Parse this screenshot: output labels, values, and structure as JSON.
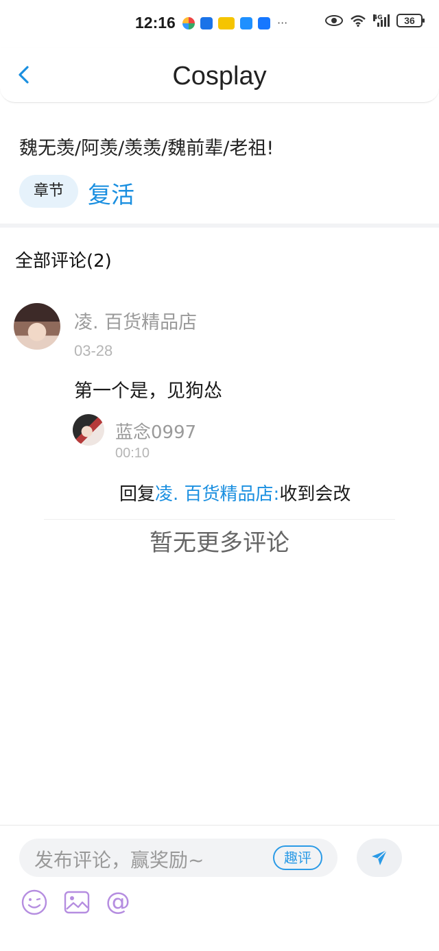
{
  "status_bar": {
    "time": "12:16",
    "dots": "···",
    "network": "4G",
    "battery": "36"
  },
  "header": {
    "back_icon": "chevron-left-icon",
    "title": "Cosplay"
  },
  "post": {
    "text": "魏无羡/阿羡/羡羡/魏前辈/老祖!",
    "chapter_tag": "章节",
    "chapter_name": "复活"
  },
  "comments": {
    "title": "全部评论(2)",
    "items": [
      {
        "user": "凌. 百货精品店",
        "date": "03-28",
        "text": "第一个是，见狗怂",
        "reply": {
          "user": "蓝念0997",
          "time": "00:10",
          "prefix": "回复",
          "mention": "凌. 百货精品店:",
          "text": "收到会改"
        }
      }
    ],
    "no_more": "暂无更多评论"
  },
  "bottom_bar": {
    "placeholder": "发布评论，赢奖励~",
    "badge": "趣评",
    "tools": [
      "emoji-icon",
      "image-icon",
      "at-icon"
    ],
    "at_symbol": "@"
  },
  "colors": {
    "accent": "#1a8fe0",
    "tag_bg": "#e6f2fb",
    "muted": "#9a9a9a",
    "icon_purple": "#b58de0"
  }
}
